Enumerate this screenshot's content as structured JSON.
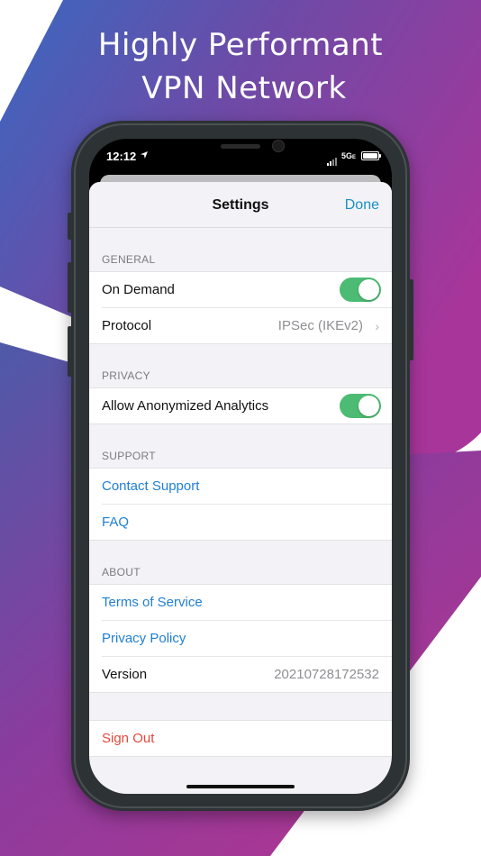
{
  "headline": {
    "line1": "Highly Performant",
    "line2": "VPN Network"
  },
  "colors": {
    "accent_blue": "#1f7fd3",
    "toggle_green": "#4cbb73",
    "danger_red": "#e5483c"
  },
  "status_bar": {
    "time": "12:12",
    "network": "5G",
    "network_suffix": "E"
  },
  "nav": {
    "title": "Settings",
    "done": "Done"
  },
  "sections": {
    "general": {
      "header": "GENERAL",
      "on_demand": {
        "label": "On Demand",
        "enabled": true
      },
      "protocol": {
        "label": "Protocol",
        "value": "IPSec (IKEv2)"
      }
    },
    "privacy": {
      "header": "PRIVACY",
      "analytics": {
        "label": "Allow Anonymized Analytics",
        "enabled": true
      }
    },
    "support": {
      "header": "SUPPORT",
      "contact": "Contact Support",
      "faq": "FAQ"
    },
    "about": {
      "header": "ABOUT",
      "terms": "Terms of Service",
      "privacy_policy": "Privacy Policy",
      "version": {
        "label": "Version",
        "value": "20210728172532"
      }
    },
    "account": {
      "sign_out": "Sign Out"
    }
  },
  "icons": {
    "location": "location-arrow-icon",
    "chevron": "chevron-right-icon",
    "signal": "signal-bars-icon",
    "battery": "battery-icon"
  }
}
